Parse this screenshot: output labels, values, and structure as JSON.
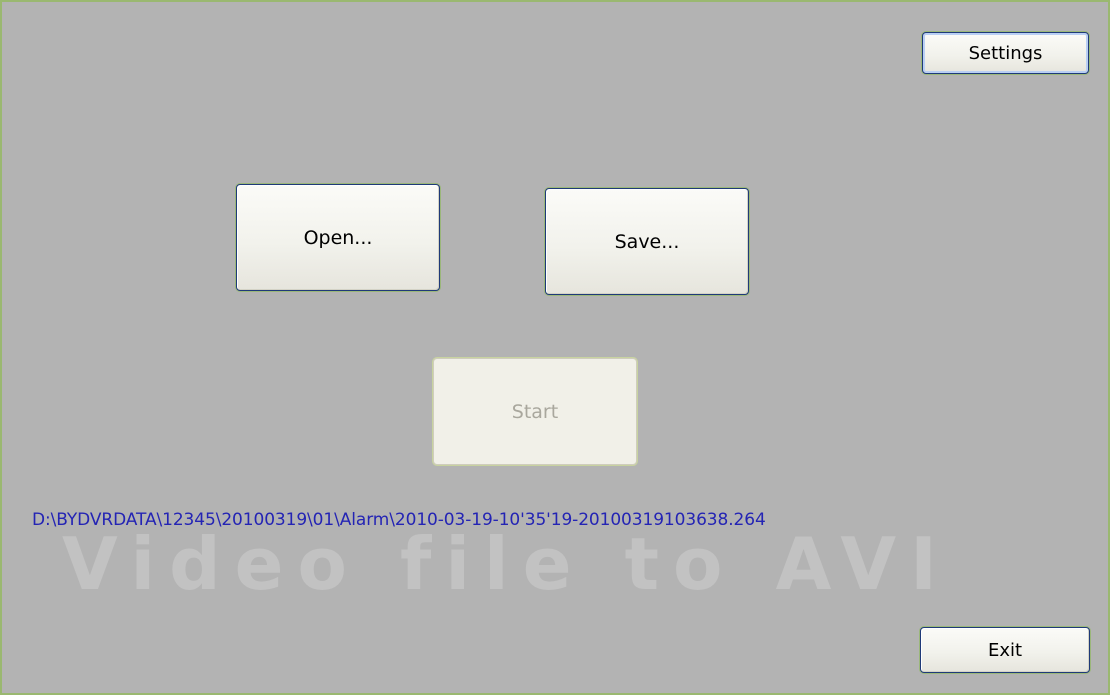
{
  "window": {
    "background_color": "#b3b3b3",
    "border_color": "#9ab870"
  },
  "buttons": {
    "settings_label": "Settings",
    "open_label": "Open...",
    "save_label": "Save...",
    "start_label": "Start",
    "exit_label": "Exit"
  },
  "status": {
    "file_path": "D:\\BYDVRDATA\\12345\\20100319\\01\\Alarm\\2010-03-19-10'35'19-20100319103638.264",
    "path_color": "#2424b4"
  },
  "watermark": {
    "text": "Video file to AVI"
  }
}
